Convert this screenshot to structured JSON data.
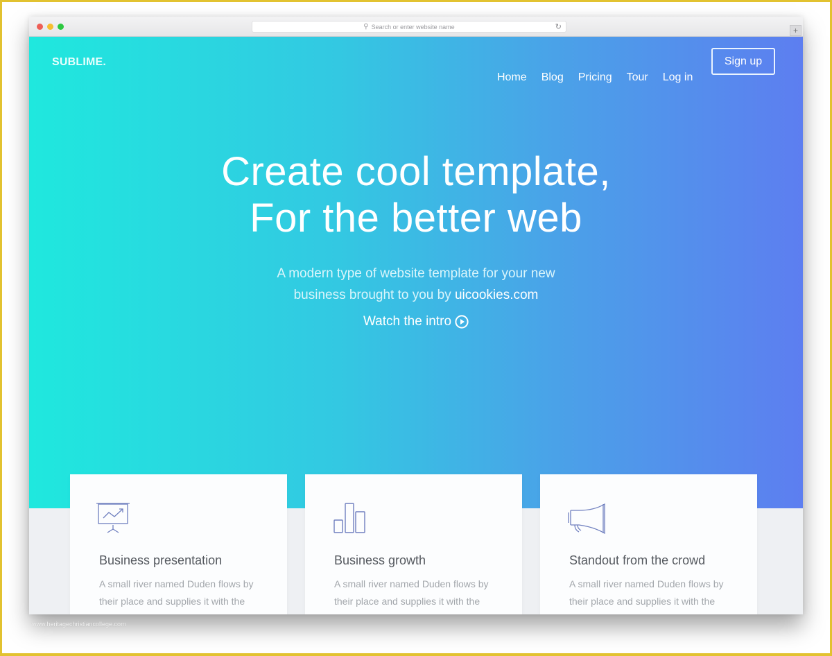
{
  "browser": {
    "address_placeholder": "Search or enter website name",
    "search_icon": "search-icon",
    "reload_icon": "reload-icon",
    "new_tab_icon": "plus-icon"
  },
  "header": {
    "logo": "SUBLIME.",
    "nav": [
      {
        "label": "Home"
      },
      {
        "label": "Blog"
      },
      {
        "label": "Pricing"
      },
      {
        "label": "Tour"
      },
      {
        "label": "Log in"
      }
    ],
    "signup_label": "Sign up"
  },
  "hero": {
    "headline_line1": "Create cool template,",
    "headline_line2": "For the better web",
    "subtitle_line1": "A modern type of website template for your new",
    "subtitle_line2_prefix": "business brought to you by ",
    "subtitle_link": "uicookies.com",
    "watch_label": "Watch the intro",
    "watch_icon": "play-circle-icon",
    "gradient_start": "#1fe8de",
    "gradient_end": "#5d7ef0"
  },
  "features": [
    {
      "icon": "presentation-chart-icon",
      "title": "Business presentation",
      "text": "A small river named Duden flows by their place and supplies it with the necessary regelialia."
    },
    {
      "icon": "bar-chart-icon",
      "title": "Business growth",
      "text": "A small river named Duden flows by their place and supplies it with the necessary regelialia."
    },
    {
      "icon": "megaphone-icon",
      "title": "Standout from the crowd",
      "text": "A small river named Duden flows by their place and supplies it with the necessary regelialia."
    }
  ],
  "watermark": "www.heritagechristiancollege.com",
  "colors": {
    "icon_stroke": "#6f7fbf",
    "card_title": "#55595f",
    "card_text": "#a2a6ab"
  }
}
